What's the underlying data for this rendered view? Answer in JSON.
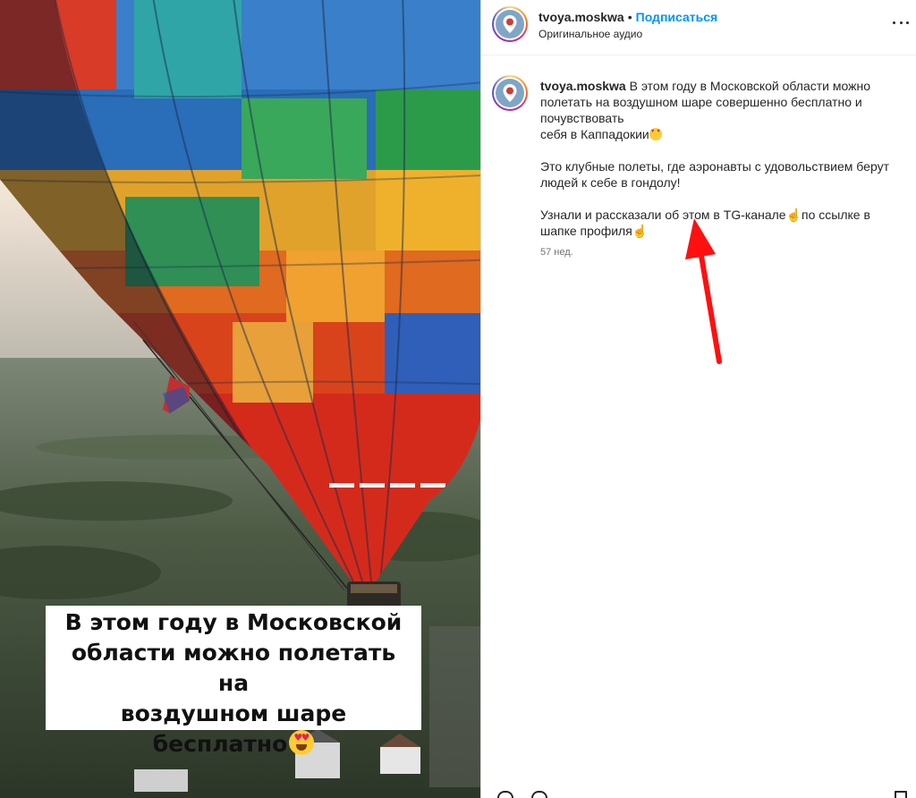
{
  "media": {
    "caption_lines": "В этом году в Московской\nобласти можно полетать на\nвоздушном шаре бесплатно",
    "caption_emoji": "heart-eyes-emoji"
  },
  "header": {
    "username": "tvoya.moskwa",
    "separator": "•",
    "follow_label": "Подписаться",
    "audio_label": "Оригинальное аудио",
    "more_icon": "more-horizontal-icon"
  },
  "comment": {
    "username": "tvoya.moskwa",
    "line1": "В этом году в Московской области можно полетать на воздушном шаре совершенно бесплатно и почувствовать",
    "line2": "себя в Каппадокии",
    "para2": "Это клубные полеты, где аэронавты с удовольствием берут людей к себе в гондолу!",
    "para3_a": "Узнали и рассказали об этом в TG-канале",
    "para3_b": "по ссылке в шапке профиля",
    "time": "57 нед."
  },
  "colors": {
    "follow": "#0095f6",
    "arrow": "#ff1010",
    "text": "#262626",
    "muted": "#737373"
  }
}
